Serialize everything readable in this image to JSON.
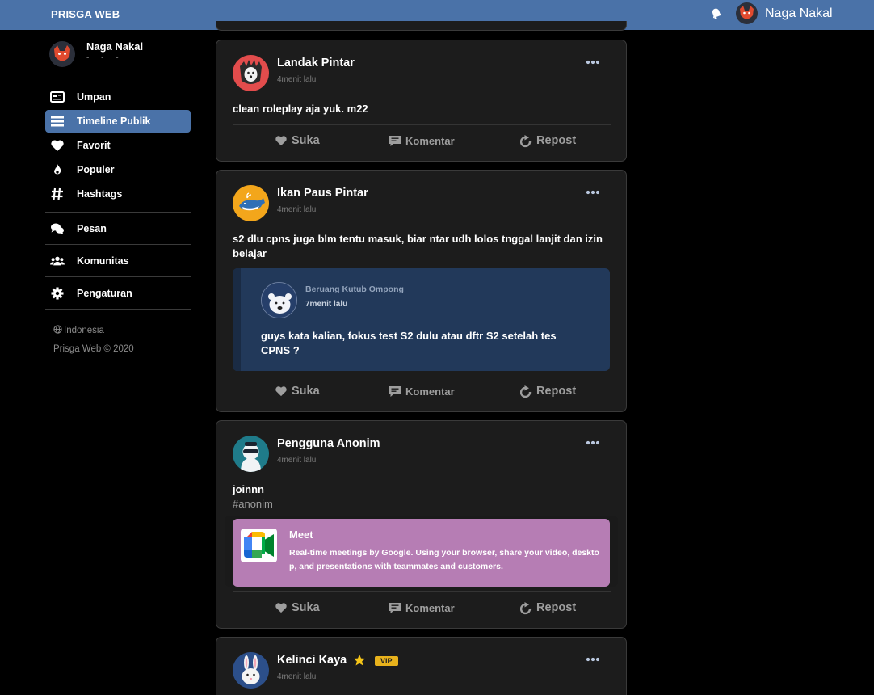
{
  "header": {
    "brand": "PRISGA WEB",
    "user_name": "Naga Nakal",
    "bg_color": "#4a72a8"
  },
  "sidebar": {
    "profile_name": "Naga Nakal",
    "profile_sub": "- - -",
    "items": [
      {
        "label": "Umpan",
        "icon": "newspaper-icon",
        "active": false
      },
      {
        "label": "Timeline Publik",
        "icon": "list-icon",
        "active": true
      },
      {
        "label": "Favorit",
        "icon": "heart-icon",
        "active": false
      },
      {
        "label": "Populer",
        "icon": "fire-icon",
        "active": false
      },
      {
        "label": "Hashtags",
        "icon": "hashtag-icon",
        "active": false
      },
      {
        "label": "Pesan",
        "icon": "chat-icon",
        "active": false
      },
      {
        "label": "Komunitas",
        "icon": "users-icon",
        "active": false
      },
      {
        "label": "Pengaturan",
        "icon": "gear-icon",
        "active": false
      }
    ],
    "language": "Indonesia",
    "copyright": "Prisga Web © 2020"
  },
  "actions": {
    "like": "Suka",
    "comment": "Komentar",
    "repost": "Repost"
  },
  "posts": [
    {
      "author": "Landak Pintar",
      "time": "4menit lalu",
      "text": "clean roleplay aja yuk. m22"
    },
    {
      "author": "Ikan Paus Pintar",
      "time": "4menit lalu",
      "text": "s2 dlu cpns juga blm tentu masuk, biar ntar udh lolos tnggal lanjit dan izin belajar",
      "quote": {
        "author": "Beruang Kutub Ompong",
        "time": "7menit lalu",
        "text": "guys kata kalian, fokus test S2 dulu atau dftr S2 setelah tes CPNS ?"
      }
    },
    {
      "author": "Pengguna Anonim",
      "time": "4menit lalu",
      "text": "joinnn",
      "tag": "#anonim",
      "link": {
        "title": "Meet",
        "description": "Real-time meetings by Google. Using your browser, share your video, desktop, and presentations with teammates and customers."
      }
    },
    {
      "author": "Kelinci Kaya",
      "time": "4menit lalu",
      "badge": "VIP"
    }
  ]
}
